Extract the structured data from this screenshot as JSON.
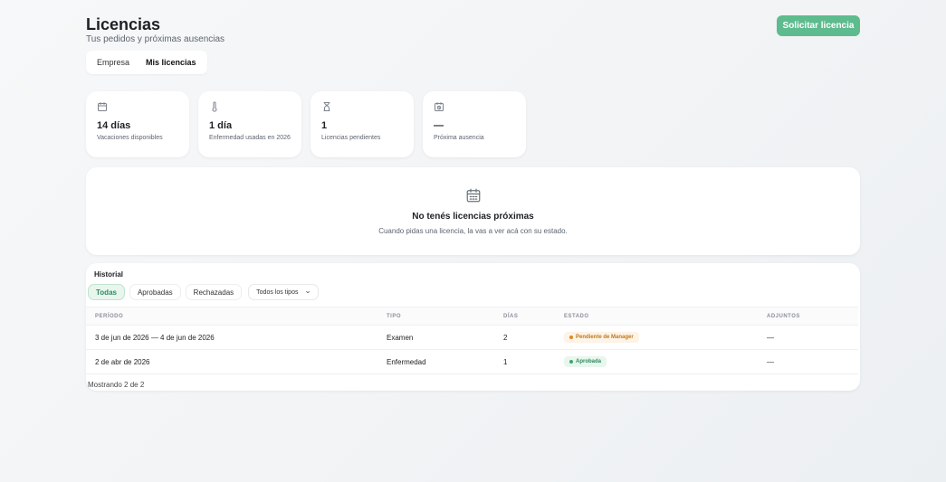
{
  "header": {
    "title": "Licencias",
    "subtitle": "Tus pedidos y próximas ausencias",
    "request_button": "Solicitar licencia"
  },
  "tabs": [
    {
      "label": "Empresa",
      "active": false
    },
    {
      "label": "Mis licencias",
      "active": true
    }
  ],
  "stats": [
    {
      "icon": "calendar-icon",
      "value": "14 días",
      "label": "Vacaciones disponibles"
    },
    {
      "icon": "thermometer-icon",
      "value": "1 día",
      "label": "Enfermedad usadas en 2026"
    },
    {
      "icon": "hourglass-icon",
      "value": "1",
      "label": "Licencias pendientes"
    },
    {
      "icon": "calendar-clock-icon",
      "value": "—",
      "label": "Próxima ausencia"
    }
  ],
  "empty_state": {
    "icon": "calendar-icon",
    "title": "No tenés licencias próximas",
    "text": "Cuando pidas una licencia, la vas a ver acá con su estado."
  },
  "history": {
    "title": "Historial",
    "filters": [
      {
        "label": "Todas",
        "active": true
      },
      {
        "label": "Aprobadas",
        "active": false
      },
      {
        "label": "Rechazadas",
        "active": false
      }
    ],
    "type_select": "Todos los tipos",
    "columns": {
      "periodo": "PERÍODO",
      "tipo": "TIPO",
      "dias": "DÍAS",
      "estado": "ESTADO",
      "adjuntos": "ADJUNTOS"
    },
    "rows": [
      {
        "periodo": "3 de jun de 2026 — 4 de jun de 2026",
        "tipo": "Examen",
        "dias": "2",
        "estado": "Pendiente de Manager",
        "adjuntos": "—"
      },
      {
        "periodo": "2 de abr de 2026",
        "tipo": "Enfermedad",
        "dias": "1",
        "estado": "Aprobada",
        "adjuntos": "—"
      }
    ],
    "footer": "Mostrando 2 de 2"
  },
  "colors": {
    "primary": "#5dbb8e",
    "pending_bg": "#fdf3e6",
    "pending_text": "#c07a1c",
    "approved_bg": "#e8f6ee",
    "approved_text": "#2f8a5d"
  }
}
